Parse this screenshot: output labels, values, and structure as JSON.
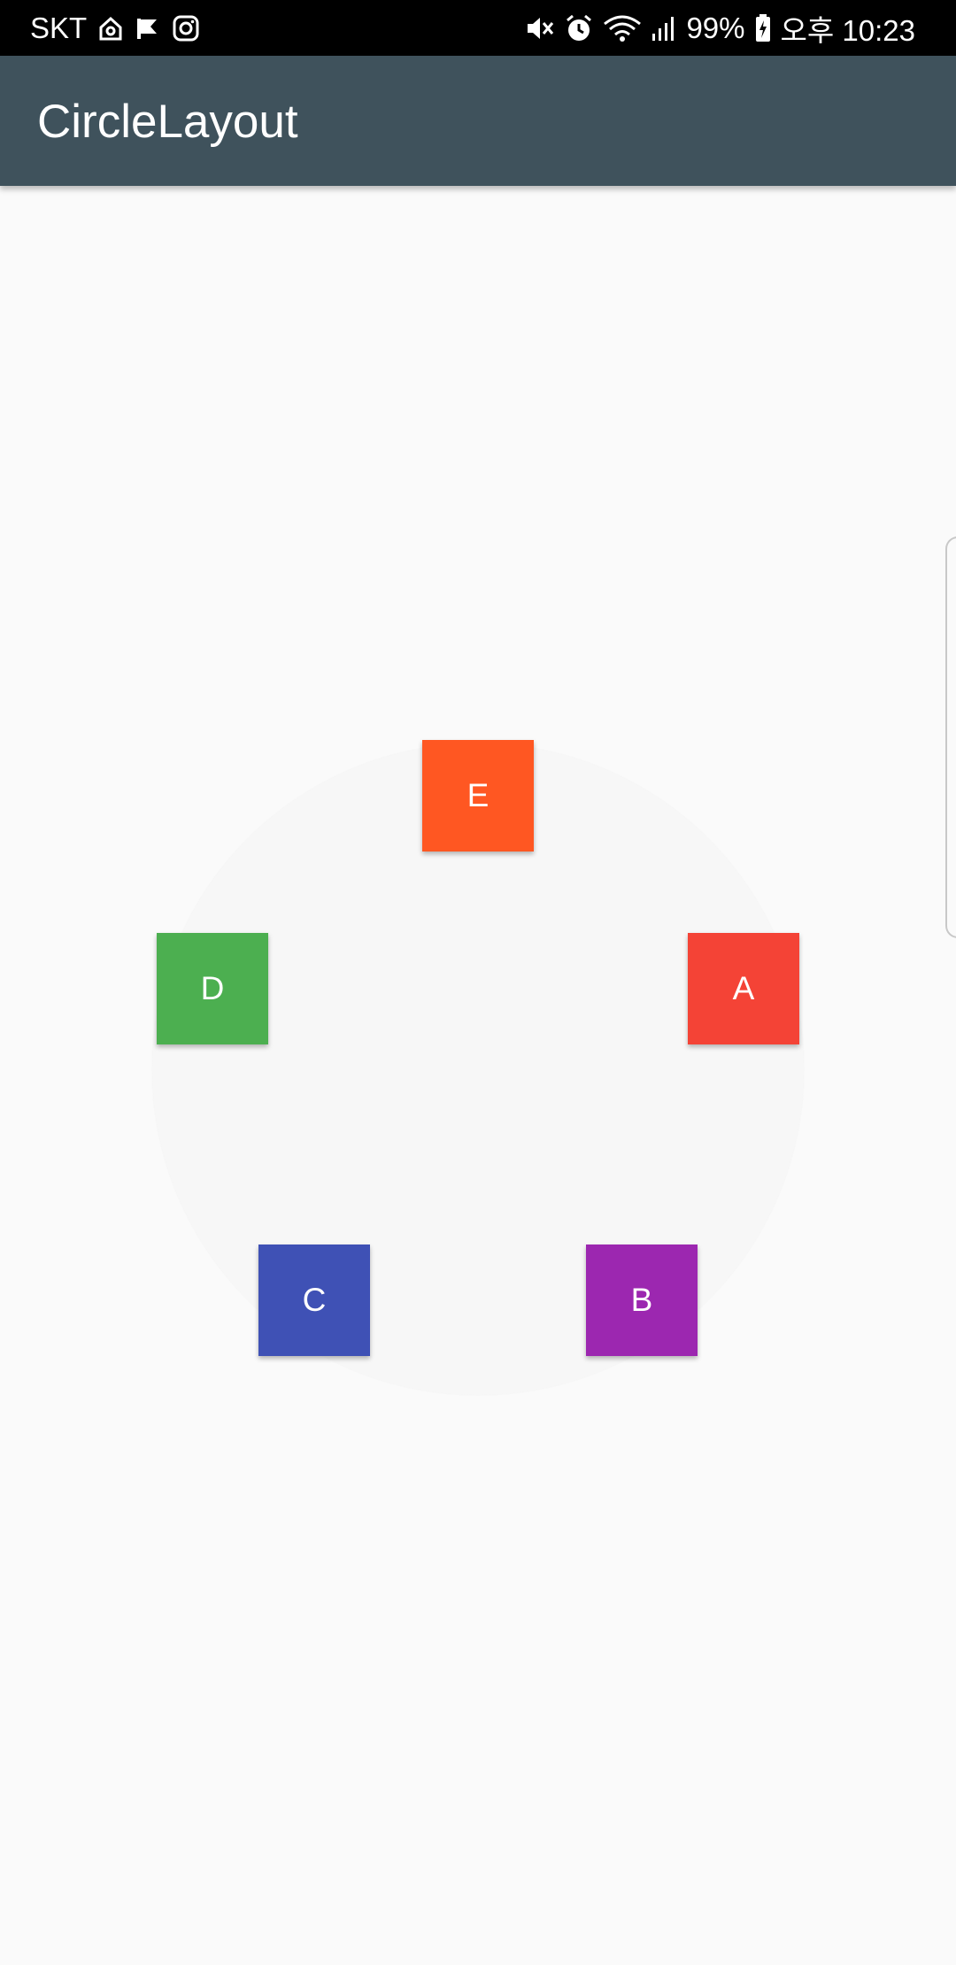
{
  "status_bar": {
    "carrier": "SKT",
    "battery": "99%",
    "time": "오후 10:23",
    "left_icons": [
      "home-icon",
      "flag-icon",
      "instagram-icon"
    ],
    "right_icons": [
      "mute-icon",
      "alarm-icon",
      "wifi-icon",
      "signal-icon",
      "battery-icon"
    ]
  },
  "app_bar": {
    "title": "CircleLayout",
    "color": "#3f525c"
  },
  "circle_layout": {
    "items": [
      {
        "label": "A",
        "color": "#f44336"
      },
      {
        "label": "B",
        "color": "#9c27b0"
      },
      {
        "label": "C",
        "color": "#3f51b5"
      },
      {
        "label": "D",
        "color": "#4caf50"
      },
      {
        "label": "E",
        "color": "#ff5722"
      }
    ]
  }
}
